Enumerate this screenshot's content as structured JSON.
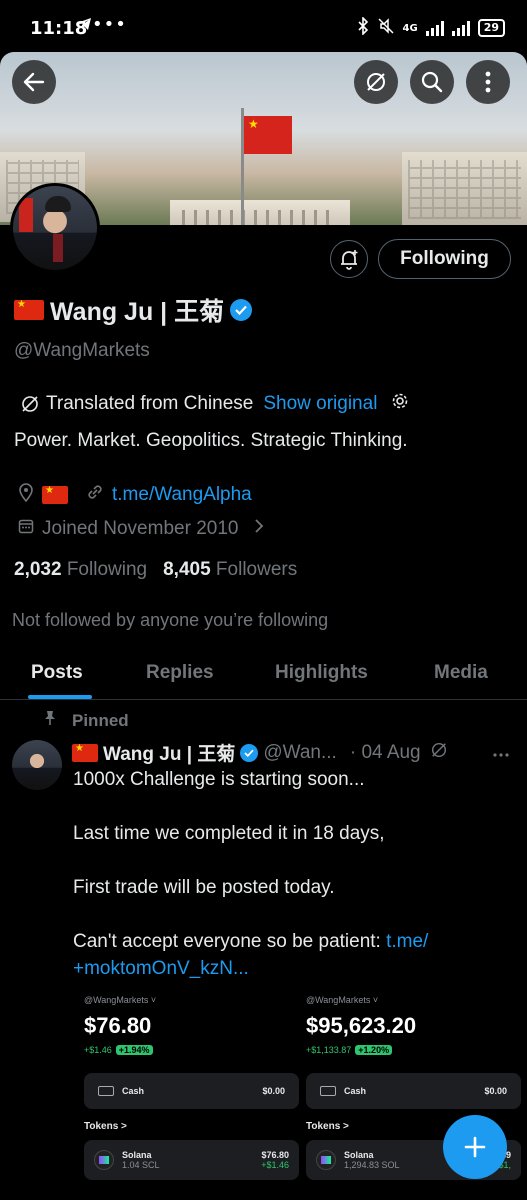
{
  "status_bar": {
    "time": "11:18",
    "dots": "•••",
    "network": "4G",
    "battery": "29"
  },
  "profile": {
    "name": "Wang Ju | 王菊",
    "handle": "@WangMarkets",
    "follow_button": "Following",
    "translated_label": "Translated from Chinese",
    "show_original": "Show original",
    "bio": "Power. Market. Geopolitics. Strategic Thinking.",
    "link": "t.me/WangAlpha",
    "joined": "Joined November 2010",
    "following_count": "2,032",
    "following_label": "Following",
    "followers_count": "8,405",
    "followers_label": "Followers",
    "not_followed": "Not followed by anyone you’re following"
  },
  "tabs": [
    "Posts",
    "Replies",
    "Highlights",
    "Media"
  ],
  "pinned_post": {
    "pinned_label": "Pinned",
    "author_name": "Wang Ju | 王菊",
    "author_handle": "@Wan...",
    "date": "· 04 Aug",
    "line1": "1000x Challenge is starting soon...",
    "line2": "Last time we completed it in 18 days,",
    "line3": "First trade will be posted today.",
    "line4_text": "Can't accept everyone so be patient: ",
    "line4_link": "t.me/ +moktomOnV_kzN...",
    "cards": [
      {
        "handle": "@WangMarkets ˅",
        "balance": "$76.80",
        "change": "+$1.46",
        "change_pct": "+1.94%",
        "cash_label": "Cash",
        "cash_value": "$0.00",
        "tokens_label": "Tokens >",
        "token_name": "Solana",
        "token_amount": "1.04 SCL",
        "token_value": "$76.80",
        "token_change": "+$1.46"
      },
      {
        "handle": "@WangMarkets ˅",
        "balance": "$95,623.20",
        "change": "+$1,133.87",
        "change_pct": "+1.20%",
        "cash_label": "Cash",
        "cash_value": "$0.00",
        "tokens_label": "Tokens >",
        "token_name": "Solana",
        "token_amount": "1,294.83 SOL",
        "token_value": "$9",
        "token_change": "+$1,"
      }
    ]
  },
  "colors": {
    "accent": "#1d9bf0",
    "muted": "#71767b",
    "positive": "#2ec56d"
  }
}
